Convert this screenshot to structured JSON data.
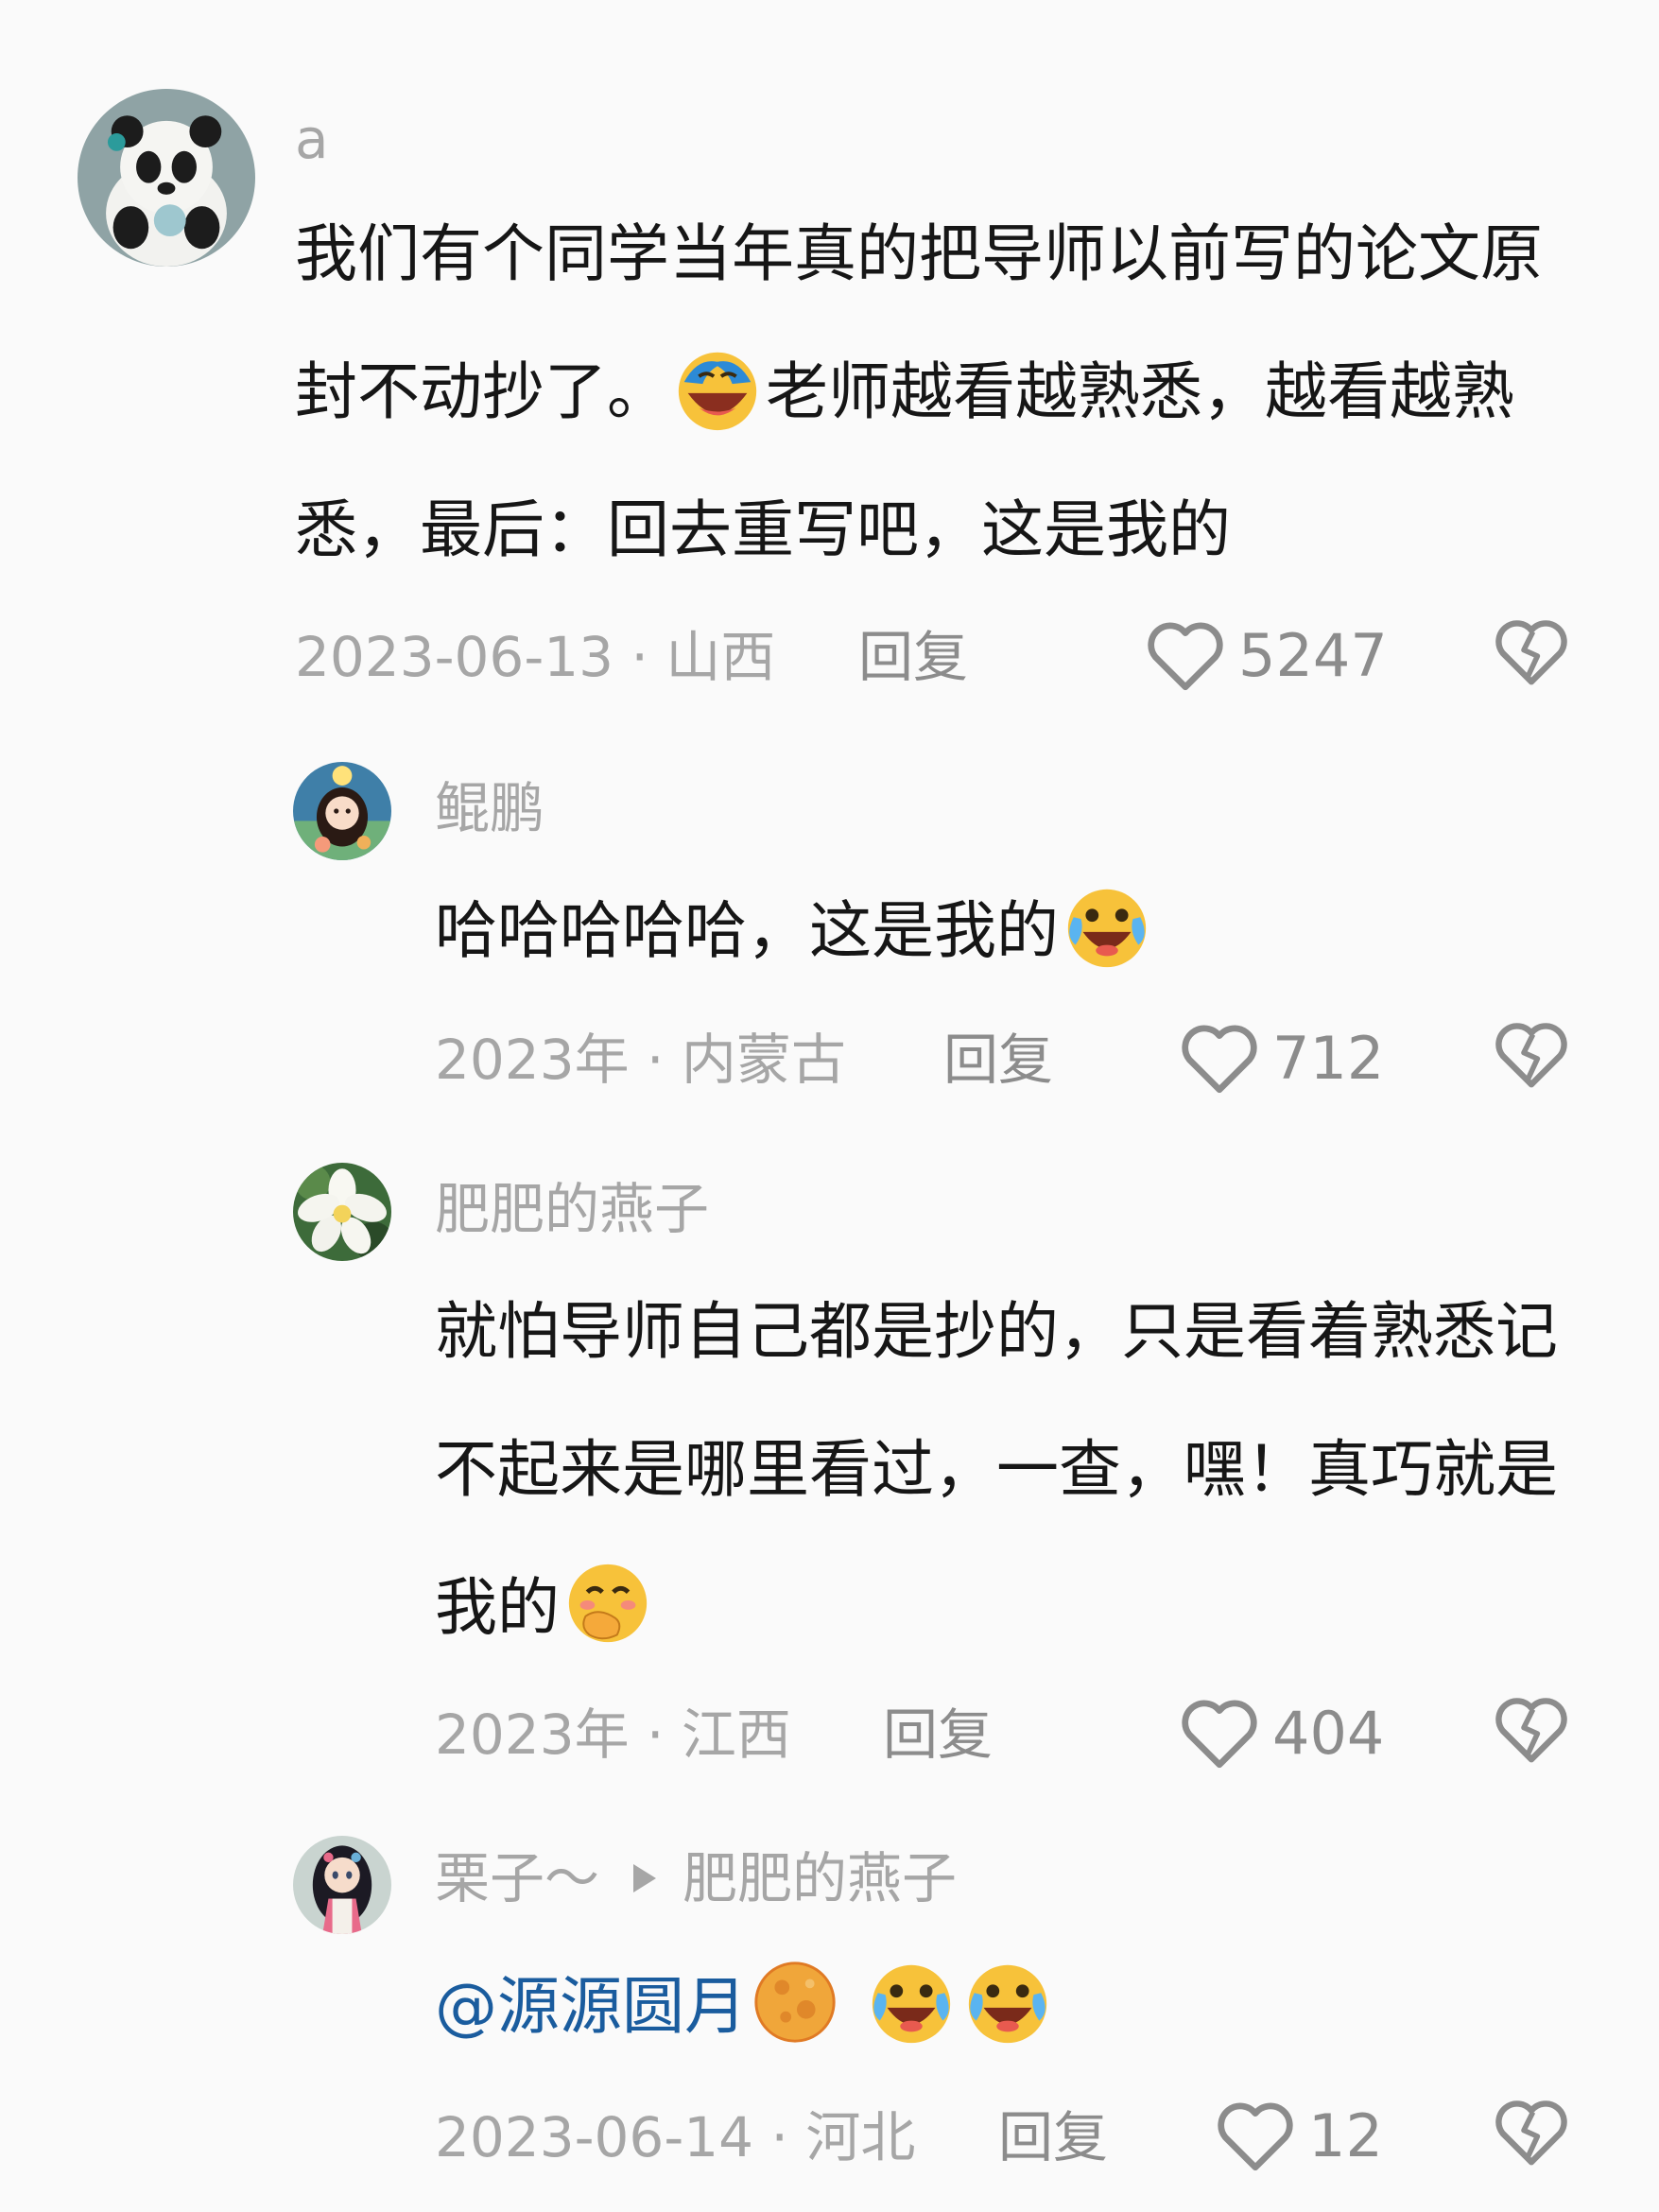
{
  "comments": [
    {
      "username": "a",
      "avatar": "panda-avatar",
      "text_parts": [
        "我们有个同学当年真的把导师以前写的论文原封不动抄了。",
        "老师越看越熟悉，越看越熟悉，最后：回去重写吧，这是我的"
      ],
      "emojis": [
        "laughing-cover-face-emoji"
      ],
      "date_location": "2023-06-13 · 山西",
      "reply_label": "回复",
      "likes": "5247"
    },
    {
      "username": "鲲鹏",
      "avatar": "girl-avatar",
      "text_parts": [
        "哈哈哈哈哈，这是我的"
      ],
      "emojis": [
        "tears-of-joy-emoji"
      ],
      "date_location": "2023年 · 内蒙古",
      "reply_label": "回复",
      "likes": "712"
    },
    {
      "username": "肥肥的燕子",
      "avatar": "flower-avatar",
      "text_parts": [
        "就怕导师自己都是抄的，只是看着熟悉记不起来是哪里看过，一查，嘿！真巧就是我的"
      ],
      "emojis": [
        "giggle-hand-emoji"
      ],
      "date_location": "2023年 · 江西",
      "reply_label": "回复",
      "likes": "404"
    },
    {
      "username": "栗子～",
      "reply_to": "肥肥的燕子",
      "avatar": "anime-girl-avatar",
      "mention": "@源源圆月",
      "emojis": [
        "moon-emoji",
        "tears-of-joy-emoji",
        "tears-of-joy-emoji"
      ],
      "date_location": "2023-06-14 · 河北",
      "reply_label": "回复",
      "likes": "12"
    }
  ],
  "colors": {
    "background": "#fafafa",
    "text": "#161616",
    "meta": "#a6a6a6",
    "mention": "#1a5c9e"
  }
}
